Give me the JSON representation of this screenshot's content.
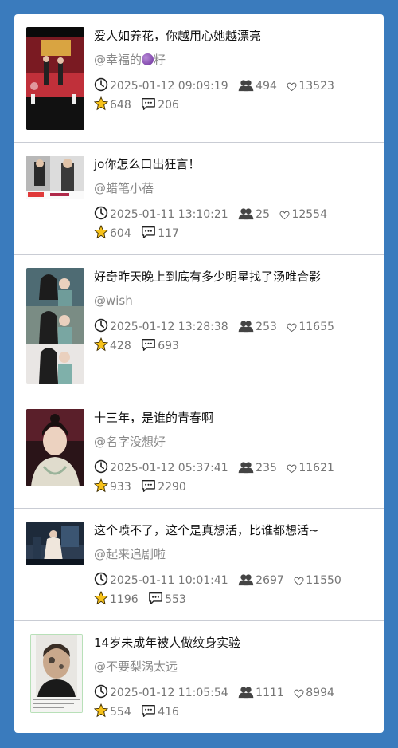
{
  "colors": {
    "background": "#3a7bbd",
    "title": "#111111",
    "author": "#8a8a8a",
    "meta": "#757575",
    "star": "#f7c21a"
  },
  "icons": [
    "clock-icon",
    "people-icon",
    "heart-icon",
    "star-icon",
    "comment-icon",
    "grape-emoji"
  ],
  "posts": [
    {
      "title": "爱人如养花，你越用心她越漂亮",
      "author": "@幸福的",
      "author_suffix": "籽",
      "time": "2025-01-12 09:09:19",
      "views": "494",
      "likes": "13523",
      "stars": "648",
      "comments": "206"
    },
    {
      "title": "jo你怎么口出狂言！",
      "author": "@蜡笔小蓓",
      "time": "2025-01-11 13:10:21",
      "views": "25",
      "likes": "12554",
      "stars": "604",
      "comments": "117"
    },
    {
      "title": "好奇昨天晚上到底有多少明星找了汤唯合影",
      "author": "@wish",
      "time": "2025-01-12 13:28:38",
      "views": "253",
      "likes": "11655",
      "stars": "428",
      "comments": "693"
    },
    {
      "title": "十三年，是谁的青春啊",
      "author": "@名字没想好",
      "time": "2025-01-12 05:37:41",
      "views": "235",
      "likes": "11621",
      "stars": "933",
      "comments": "2290"
    },
    {
      "title": "这个喷不了，这个是真想活，比谁都想活~",
      "author": "@起来追剧啦",
      "time": "2025-01-11 10:01:41",
      "views": "2697",
      "likes": "11550",
      "stars": "1196",
      "comments": "553"
    },
    {
      "title": "14岁未成年被人做纹身实验",
      "author": "@不要梨涡太远",
      "time": "2025-01-12 11:05:54",
      "views": "1111",
      "likes": "8994",
      "stars": "554",
      "comments": "416"
    }
  ]
}
